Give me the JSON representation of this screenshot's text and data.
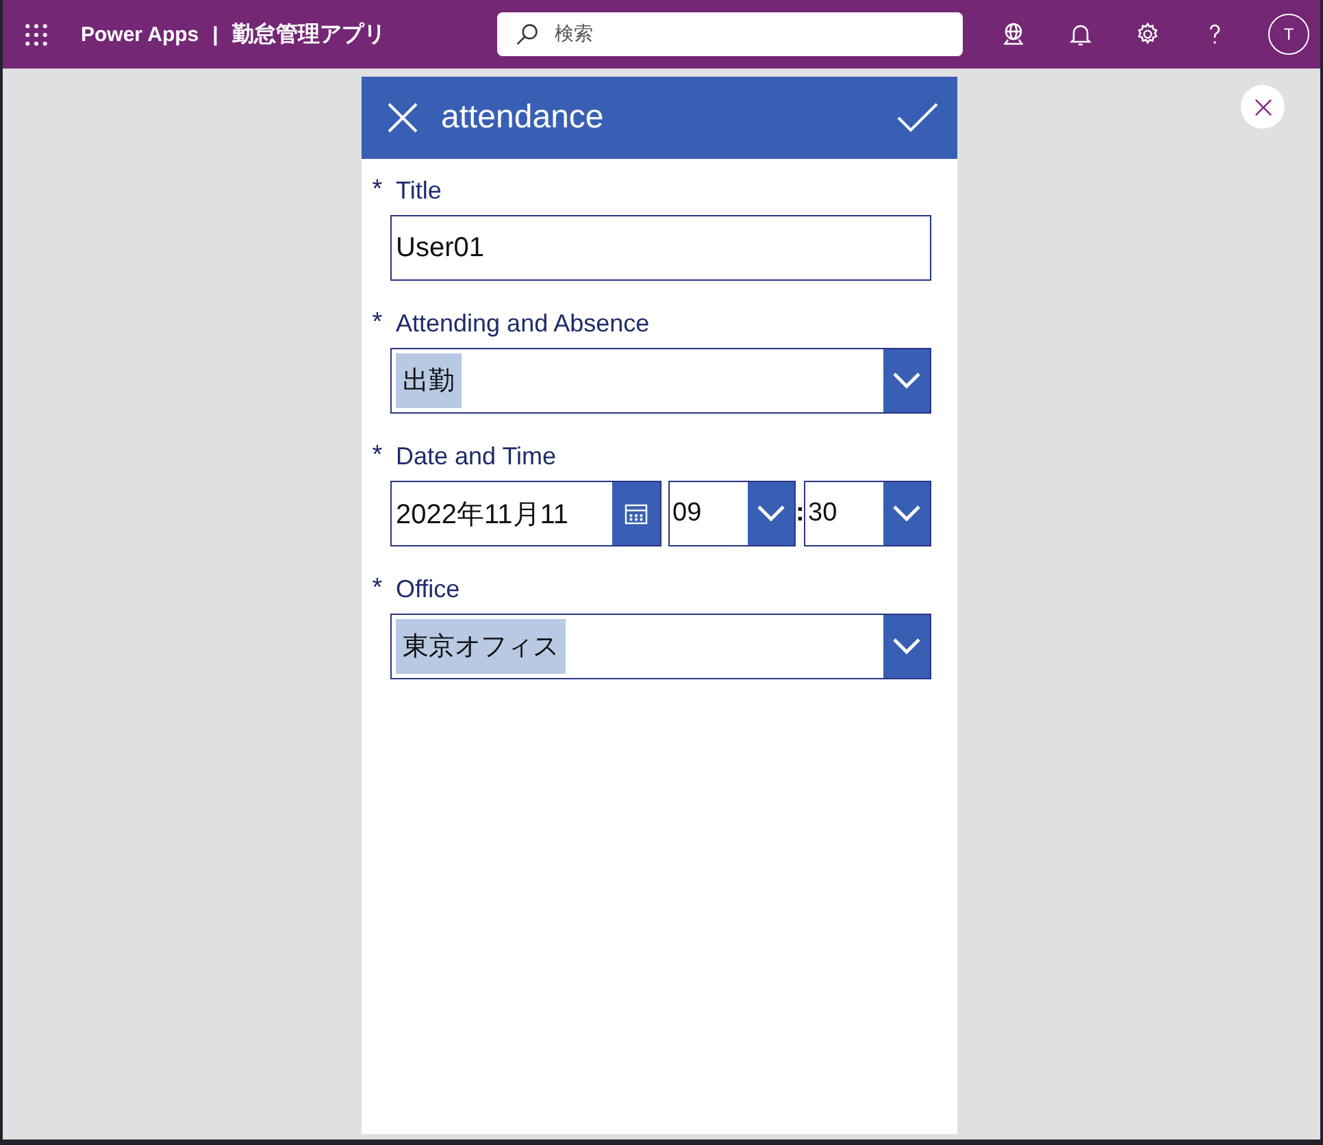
{
  "app_bar": {
    "app_name": "Power Apps",
    "separator": "|",
    "title": "勤怠管理アプリ",
    "search": {
      "placeholder": "検索"
    },
    "avatar": "T"
  },
  "form": {
    "title": "attendance",
    "fields": [
      {
        "kind": "text",
        "marker": "*",
        "label": "Title",
        "value": "User01"
      },
      {
        "kind": "combo",
        "marker": "*",
        "label": "Attending and Absence",
        "tags": [
          "出勤"
        ]
      },
      {
        "kind": "datetime",
        "marker": "*",
        "label": "Date and Time",
        "date": "2022年11月11",
        "hour": "09",
        "separator": ":",
        "minute": "30"
      },
      {
        "kind": "combo",
        "marker": "*",
        "label": "Office",
        "tags": [
          "東京オフィス"
        ]
      }
    ]
  }
}
